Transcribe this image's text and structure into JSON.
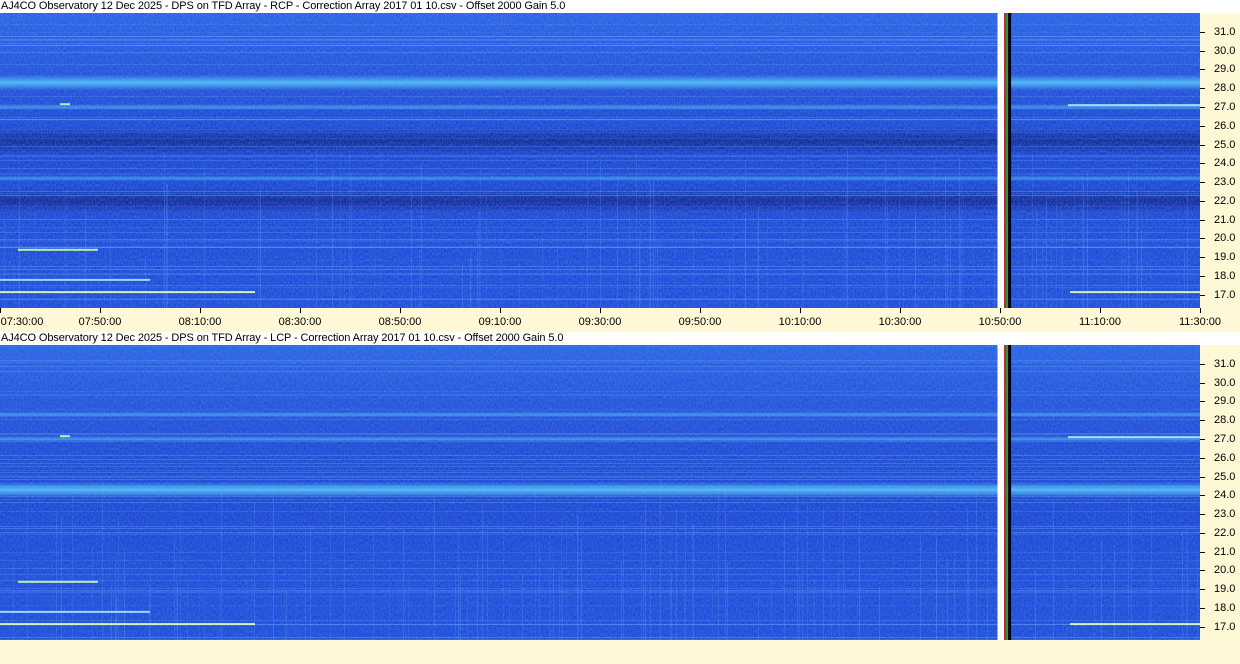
{
  "chart_data": [
    {
      "type": "heatmap",
      "title": "AJ4CO Observatory 12 Dec 2025  -  DPS on TFD Array  -  RCP  -  Correction Array 2017 01 10.csv  -  Offset 2000  Gain 5.0",
      "polarization": "RCP",
      "x_ticks": [
        "07:30:00",
        "07:50:00",
        "08:10:00",
        "08:30:00",
        "08:50:00",
        "09:10:00",
        "09:30:00",
        "09:50:00",
        "10:10:00",
        "10:30:00",
        "10:50:00",
        "11:10:00",
        "11:30:00"
      ],
      "xlim": [
        "07:30:00",
        "11:30:00"
      ],
      "y_ticks": [
        17.0,
        18.0,
        19.0,
        20.0,
        21.0,
        22.0,
        23.0,
        24.0,
        25.0,
        26.0,
        27.0,
        28.0,
        29.0,
        30.0,
        31.0
      ],
      "y_tick_labels": [
        "17.0",
        "18.0",
        "19.0",
        "20.0",
        "21.0",
        "22.0",
        "23.0",
        "24.0",
        "25.0",
        "26.0",
        "27.0",
        "28.0",
        "29.0",
        "30.0",
        "31.0"
      ],
      "ylim": [
        16.3,
        32.0
      ],
      "bright_bands_mhz": [
        28.3,
        27.0,
        23.2
      ],
      "dark_bands_mhz": [
        22.0,
        25.2
      ],
      "data_gap": [
        "10:49:30",
        "10:51:00"
      ]
    },
    {
      "type": "heatmap",
      "title": "AJ4CO Observatory 12 Dec 2025  -  DPS on TFD Array  -  LCP  -  Correction Array 2017 01 10.csv  -  Offset 2000  Gain 5.0",
      "polarization": "LCP",
      "x_ticks": [],
      "xlim": [
        "07:30:00",
        "11:30:00"
      ],
      "y_ticks": [
        17.0,
        18.0,
        19.0,
        20.0,
        21.0,
        22.0,
        23.0,
        24.0,
        25.0,
        26.0,
        27.0,
        28.0,
        29.0,
        30.0,
        31.0
      ],
      "y_tick_labels": [
        "17.0",
        "18.0",
        "19.0",
        "20.0",
        "21.0",
        "22.0",
        "23.0",
        "24.0",
        "25.0",
        "26.0",
        "27.0",
        "28.0",
        "29.0",
        "30.0",
        "31.0"
      ],
      "ylim": [
        16.3,
        32.0
      ],
      "bright_bands_mhz": [
        24.3,
        28.3,
        27.0
      ],
      "dark_bands_mhz": [],
      "data_gap": [
        "10:49:30",
        "10:51:00"
      ]
    }
  ],
  "colors": {
    "axis_background": "#fff8d6",
    "spectrogram_base": "#1848d8",
    "spectrogram_dark": "#0a1f8a",
    "spectrogram_bright": "#4cc0f5",
    "gap_white": "#ffffff",
    "gap_dark": "#000010",
    "gap_red": "#d02020",
    "gap_green": "#20a040"
  }
}
